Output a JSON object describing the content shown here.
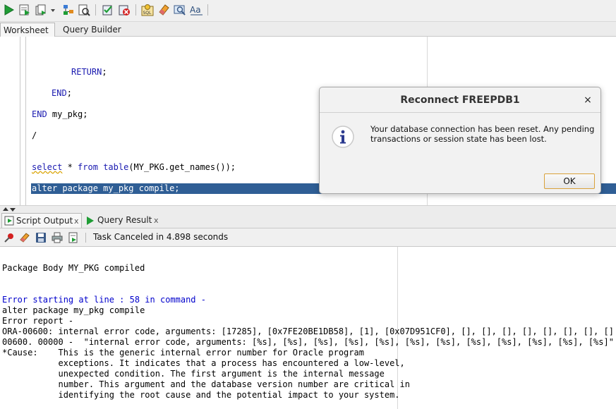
{
  "toolbar": {
    "buttons": [
      "run-statement",
      "run-script",
      "autotrace",
      "explain-plan",
      "sql-tuning-advisor",
      "commit",
      "rollback",
      "sql-worksheet-history",
      "clear",
      "unshared-sql",
      "to-upper-case"
    ]
  },
  "tabs": {
    "worksheet": "Worksheet",
    "query_builder": "Query Builder"
  },
  "editor": {
    "lines": {
      "l1_kw": "RETURN",
      "l1_rest": ";",
      "l2_kw": "END",
      "l2_rest": ";",
      "l3_kw": "END",
      "l3_rest": " my_pkg;",
      "l4": "/",
      "l5_kw1": "select",
      "l5_mid": " * ",
      "l5_kw2": "from",
      "l5_kw3": "table",
      "l5_rest": "(MY_PKG.get_names());",
      "l6": "alter package my_pkg compile;"
    }
  },
  "output_tabs": {
    "script_output": "Script Output",
    "script_close": "x",
    "query_result": "Query Result",
    "query_close": "x"
  },
  "output_toolbar": {
    "status": "Task Canceled in 4.898 seconds"
  },
  "output": {
    "lines": [
      "Package Body MY_PKG compiled",
      "Error starting at line : 58 in command -",
      "alter package my_pkg compile",
      "Error report -",
      "ORA-00600: internal error code, arguments: [17285], [0x7FE20BE1DB58], [1], [0x07D951CF0], [], [], [], [], [], [], [], []",
      "00600. 00000 -  \"internal error code, arguments: [%s], [%s], [%s], [%s], [%s], [%s], [%s], [%s], [%s], [%s], [%s], [%s]\"",
      "*Cause:    This is the generic internal error number for Oracle program",
      "           exceptions. It indicates that a process has encountered a low-level,",
      "           unexpected condition. The first argument is the internal message",
      "           number. This argument and the database version number are critical in",
      "           identifying the root cause and the potential impact to your system."
    ]
  },
  "dialog": {
    "title": "Reconnect FREEPDB1",
    "close": "×",
    "message": "Your database connection has been reset.  Any pending transactions or session state has been lost.",
    "ok": "OK"
  },
  "colors": {
    "keyword": "#1a1ab0",
    "selection": "#2f5e95",
    "error_blue": "#0000cc"
  }
}
